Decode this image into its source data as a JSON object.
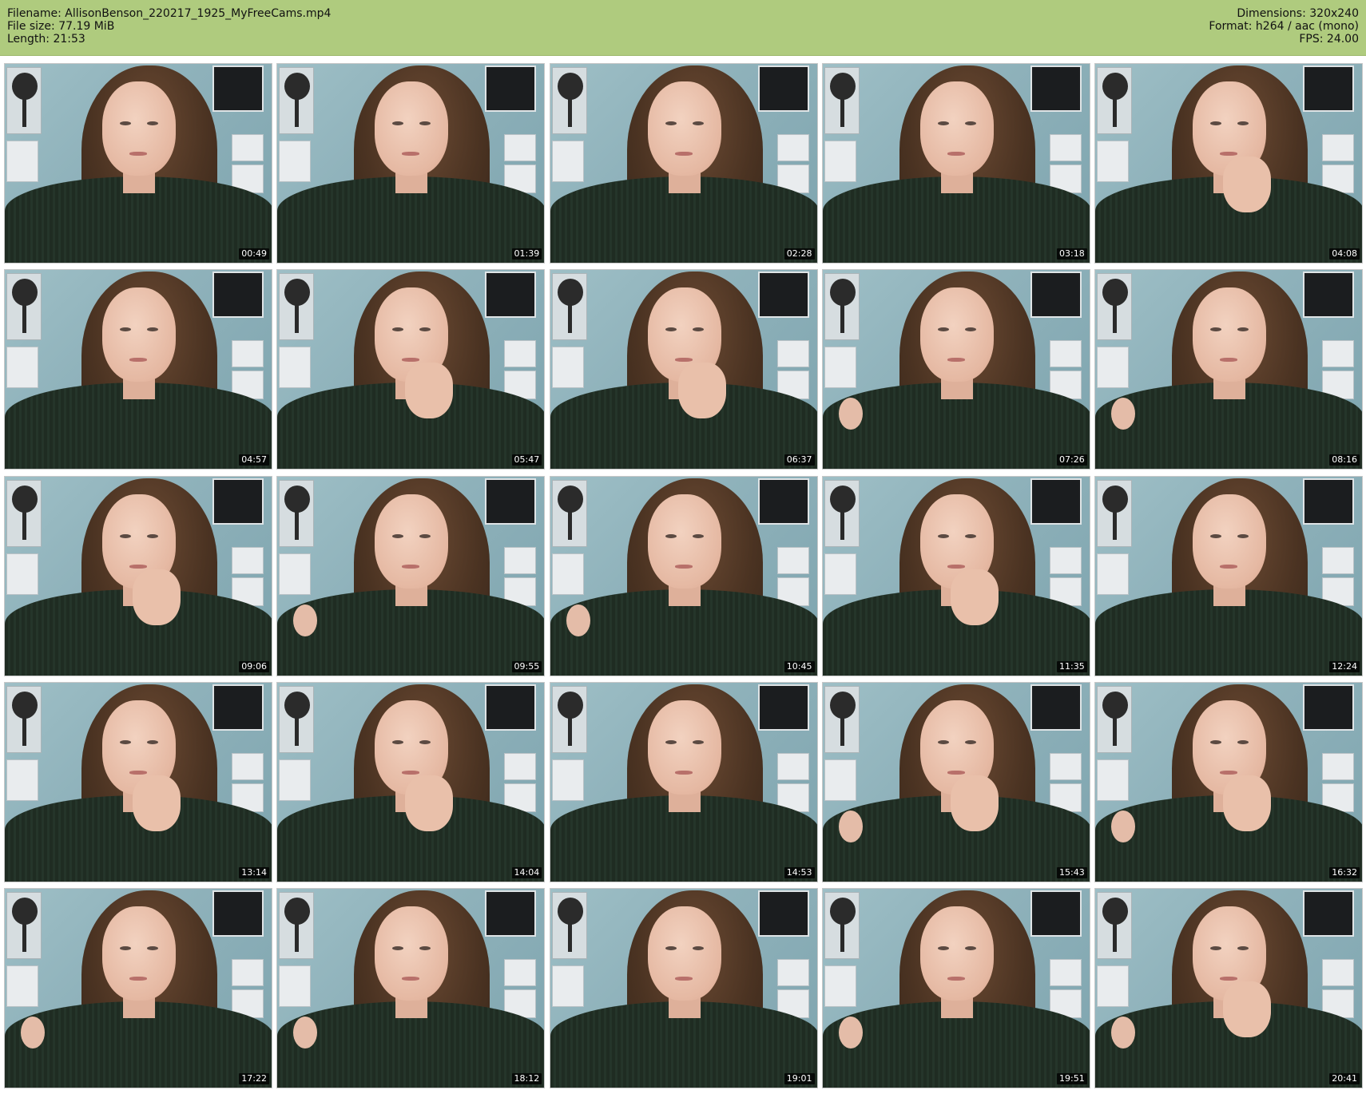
{
  "header": {
    "filename_line": "Filename: AllisonBenson_220217_1925_MyFreeCams.mp4",
    "filesize_line": "File size: 77.19 MiB",
    "length_line": "Length: 21:53",
    "dimensions_line": "Dimensions: 320x240",
    "format_line": "Format: h264 / aac (mono)",
    "fps_line": "FPS: 24.00",
    "background_color": "#afcb7e"
  },
  "thumbnails": [
    {
      "time": "00:49",
      "hand": false,
      "shoulder": false
    },
    {
      "time": "01:39",
      "hand": false,
      "shoulder": false
    },
    {
      "time": "02:28",
      "hand": false,
      "shoulder": false
    },
    {
      "time": "03:18",
      "hand": false,
      "shoulder": false
    },
    {
      "time": "04:08",
      "hand": true,
      "shoulder": false
    },
    {
      "time": "04:57",
      "hand": false,
      "shoulder": false
    },
    {
      "time": "05:47",
      "hand": true,
      "shoulder": false
    },
    {
      "time": "06:37",
      "hand": true,
      "shoulder": false
    },
    {
      "time": "07:26",
      "hand": false,
      "shoulder": true
    },
    {
      "time": "08:16",
      "hand": false,
      "shoulder": true
    },
    {
      "time": "09:06",
      "hand": true,
      "shoulder": false
    },
    {
      "time": "09:55",
      "hand": false,
      "shoulder": true
    },
    {
      "time": "10:45",
      "hand": false,
      "shoulder": true
    },
    {
      "time": "11:35",
      "hand": true,
      "shoulder": false
    },
    {
      "time": "12:24",
      "hand": false,
      "shoulder": false
    },
    {
      "time": "13:14",
      "hand": true,
      "shoulder": false
    },
    {
      "time": "14:04",
      "hand": true,
      "shoulder": false
    },
    {
      "time": "14:53",
      "hand": false,
      "shoulder": false
    },
    {
      "time": "15:43",
      "hand": true,
      "shoulder": true
    },
    {
      "time": "16:32",
      "hand": true,
      "shoulder": true
    },
    {
      "time": "17:22",
      "hand": false,
      "shoulder": true
    },
    {
      "time": "18:12",
      "hand": false,
      "shoulder": true
    },
    {
      "time": "19:01",
      "hand": false,
      "shoulder": false
    },
    {
      "time": "19:51",
      "hand": false,
      "shoulder": true
    },
    {
      "time": "20:41",
      "hand": true,
      "shoulder": true
    }
  ]
}
